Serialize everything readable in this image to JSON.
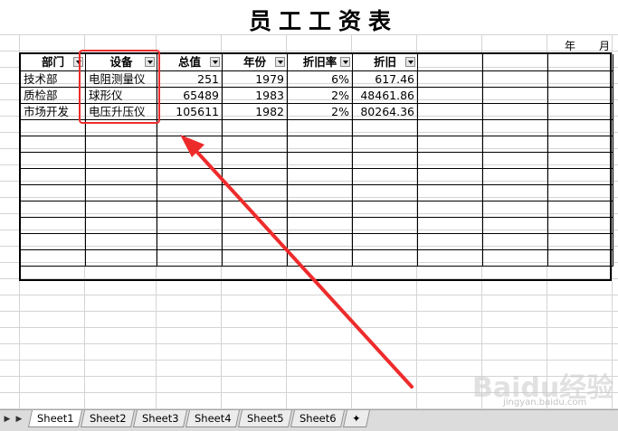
{
  "title": "员工工资表",
  "date_labels": {
    "year": "年",
    "month": "月"
  },
  "headers": [
    "部门",
    "设备",
    "总值",
    "年份",
    "折旧率",
    "折旧"
  ],
  "rows": [
    [
      "技术部",
      "电阻测量仪",
      "251",
      "1979",
      "6%",
      "617.46"
    ],
    [
      "质检部",
      "球形仪",
      "65489",
      "1983",
      "2%",
      "48461.86"
    ],
    [
      "市场开发",
      "电压升压仪",
      "105611",
      "1982",
      "2%",
      "80264.36"
    ]
  ],
  "sheet_tabs": [
    "Sheet1",
    "Sheet2",
    "Sheet3",
    "Sheet4",
    "Sheet5",
    "Sheet6"
  ],
  "active_tab": "Sheet1",
  "watermark": {
    "logo": "Baidu经验",
    "url": "jingyan.baidu.com"
  },
  "colors": {
    "annotation": "#ee2b2b",
    "grid": "#d4d4d4",
    "tabbar": "#dcdcdc"
  }
}
